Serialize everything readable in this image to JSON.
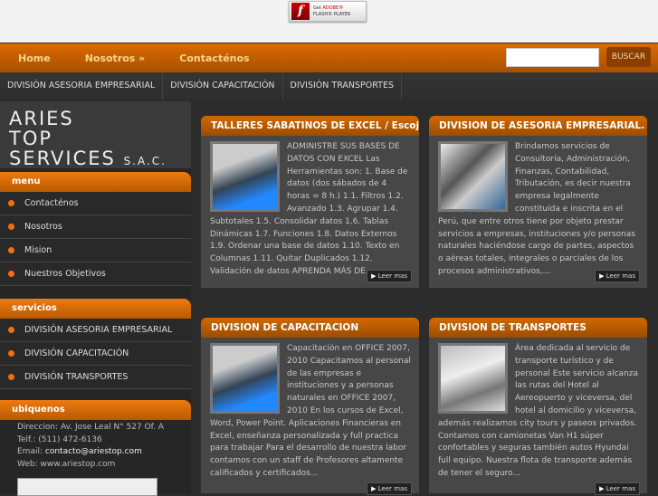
{
  "flash": {
    "get": "Get",
    "adobe": "ADOBE®",
    "player": "FLASH® PLAYER"
  },
  "nav": {
    "items": [
      "Home",
      "Nosotros »",
      "Contacténos"
    ],
    "search_value": "",
    "search_button": "BUSCAR"
  },
  "subnav": [
    "DIVISIÓN ASESORIA EMPRESARIAL",
    "DIVISIÓN CAPACITACIÓN",
    "DIVISIÓN TRANSPORTES"
  ],
  "logo": {
    "l1": "ARIES",
    "l2": "TOP",
    "l3": "SERVICES",
    "sac": "S.A.C."
  },
  "sidebar": {
    "menu_title": "menu",
    "menu": [
      "Contacténos",
      "Nosotros",
      "Mision",
      "Nuestros Objetivos"
    ],
    "servicios_title": "servicios",
    "servicios": [
      "DIVISIÓN ASESORIA EMPRESARIAL",
      "DIVISIÓN CAPACITACIÓN",
      "DIVISIÓN TRANSPORTES"
    ],
    "ubiquenos_title": "ubiquenos",
    "direccion": "Direccion: Av. Jose Leal N° 527 Of. A",
    "telf": "Telf.:  (511) 472-6136",
    "email_label": "Email:",
    "email": "contacto@ariestop.com",
    "web": "Web: www.ariestop.com"
  },
  "cards": [
    {
      "title": "TALLERES SABATINOS DE EXCEL / Escoja...",
      "text": "ADMINISTRE SUS BASES DE DATOS CON EXCEL Las Herramientas son: 1. Base de datos (dos sábados de 4 horas = 8 h.) 1.1. Filtros 1.2. Avanzado 1.3. Agrupar 1.4. Subtotales 1.5. Consolidar datos 1.6. Tablas Dinámicas 1.7. Funciones 1.8. Datos Externos 1.9. Ordenar una base de datos 1.10. Texto en Columnas 1.11. Quitar Duplicados 1.12. Validación de datos APRENDA MÁS DE...",
      "more": "Leer mas"
    },
    {
      "title": "DIVISION DE ASESORIA EMPRESARIAL.",
      "text": "Brindamos servicios de Consultoría, Administración, Finanzas, Contabilidad, Tributación, es decir nuestra empresa legalmente constituida e inscrita en el Perú, que entre otros tiene por objeto prestar servicios a empresas, instituciones y/o personas naturales haciéndose cargo de partes, aspectos o aéreas totales, integrales o parciales de los procesos administrativos,...",
      "more": "Leer mas"
    },
    {
      "title": "DIVISION DE CAPACITACION",
      "text": "Capacitación en OFFICE 2007, 2010 Capacitamos al personal  de las  empresas e instituciones y a personas naturales en OFFICE 2007, 2010 En los cursos de Excel, Word, Power Point. Aplicaciones Financieras en Excel, enseñanza personalizada y full practica para trabajar Para el desarrollo de nuestra labor contamos con un staff de Profesores altamente calificados y  certificados...",
      "more": "Leer mas"
    },
    {
      "title": "DIVISION DE TRANSPORTES",
      "text": "Área dedicada al servicio de transporte turístico y de personal Este servicio alcanza las rutas del Hotel al Aereopuerto y viceversa, del hotel al domicilio y viceversa, además realizamos city  tours y paseos privados. Contamos con camionetas  Van H1 súper confortables y seguras también  autos Hyundai full equipo. Nuestra flota de transporte además de tener  el seguro...",
      "more": "Leer mas"
    }
  ]
}
